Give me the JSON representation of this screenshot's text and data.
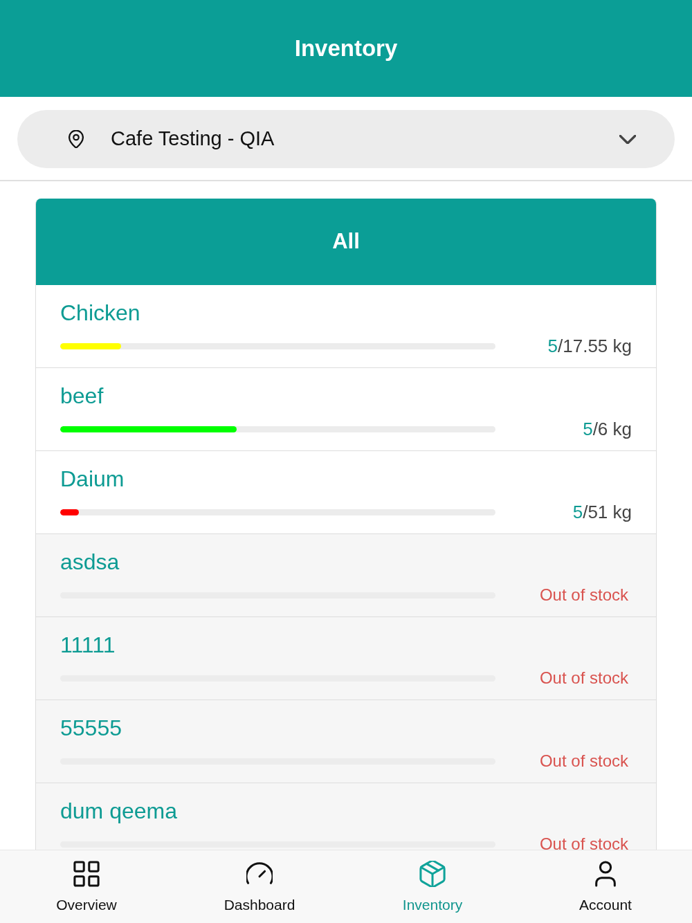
{
  "header": {
    "title": "Inventory"
  },
  "location_selector": {
    "value": "Cafe Testing - QIA"
  },
  "category": {
    "label": "All"
  },
  "items": [
    {
      "kind": "in_stock",
      "name": "Chicken",
      "level": 0.14,
      "color": "#ffff00",
      "amount": "5",
      "capacity": "/17.55 kg"
    },
    {
      "kind": "in_stock",
      "name": "beef",
      "level": 0.405,
      "color": "#00ff00",
      "amount": "5",
      "capacity": "/6 kg"
    },
    {
      "kind": "in_stock",
      "name": "Daium",
      "level": 0.043,
      "color": "#ff0000",
      "amount": "5",
      "capacity": "/51 kg"
    },
    {
      "kind": "out_of_stock",
      "name": "asdsa",
      "status": "Out of stock"
    },
    {
      "kind": "out_of_stock",
      "name": "11111",
      "status": "Out of stock"
    },
    {
      "kind": "out_of_stock",
      "name": "55555",
      "status": "Out of stock"
    },
    {
      "kind": "out_of_stock",
      "name": "dum qeema",
      "status": "Out of stock"
    }
  ],
  "tab_bar": [
    {
      "label": "Overview",
      "selected": false
    },
    {
      "label": "Dashboard",
      "selected": false
    },
    {
      "label": "Inventory",
      "selected": true
    },
    {
      "label": "Account",
      "selected": false
    }
  ]
}
